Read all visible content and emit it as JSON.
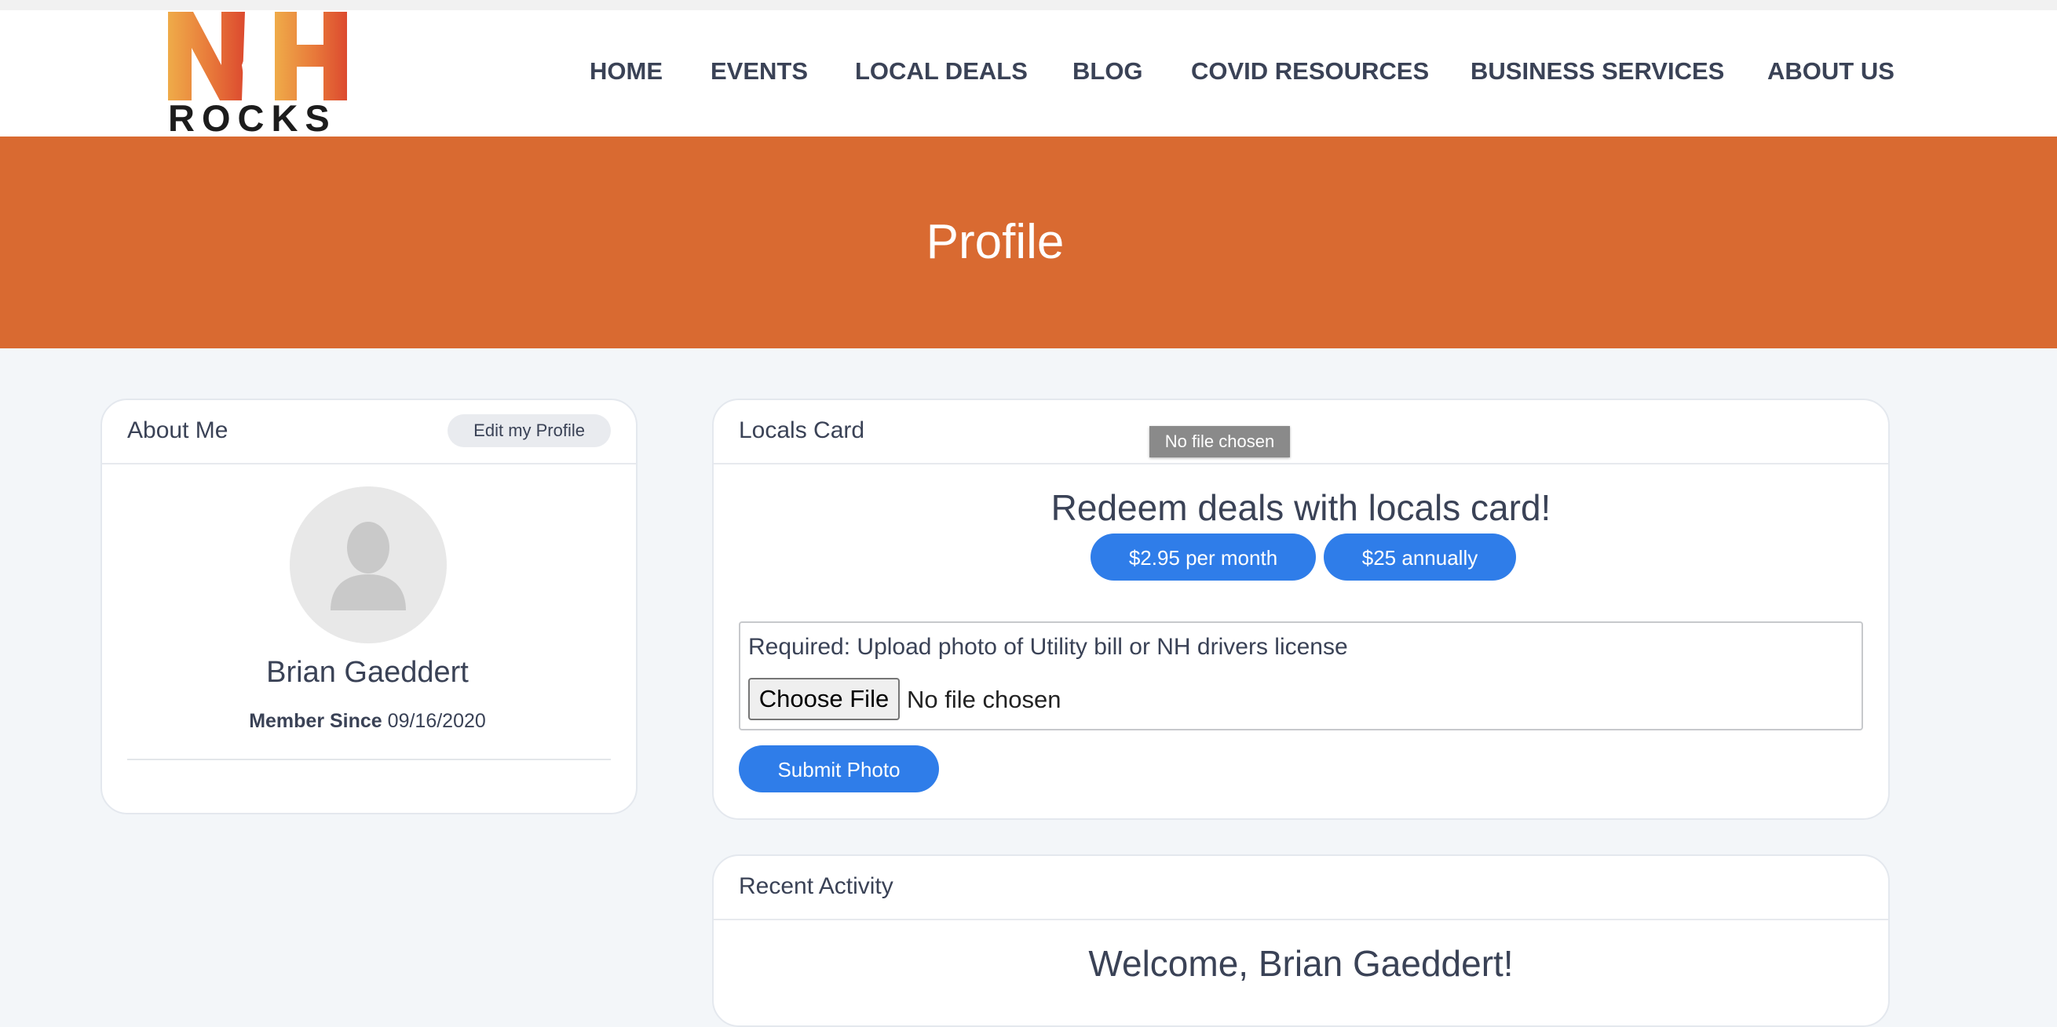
{
  "brand": {
    "logo_text": "NH",
    "logo_subtext": "ROCKS"
  },
  "nav": {
    "items": [
      "HOME",
      "EVENTS",
      "LOCAL DEALS",
      "BLOG",
      "COVID RESOURCES",
      "BUSINESS SERVICES",
      "ABOUT US"
    ]
  },
  "hero": {
    "title": "Profile"
  },
  "about": {
    "title": "About Me",
    "edit_label": "Edit my Profile",
    "name": "Brian Gaeddert",
    "member_since_label": "Member Since",
    "member_since_value": "09/16/2020"
  },
  "locals_card": {
    "title": "Locals Card",
    "headline": "Redeem deals with locals card!",
    "monthly_label": "$2.95 per month",
    "annual_label": "$25 annually",
    "upload_instruction": "Required: Upload photo of Utility bill or NH drivers license",
    "choose_file_label": "Choose File",
    "no_file_text": "No file chosen",
    "submit_label": "Submit Photo",
    "tooltip_text": "No file chosen"
  },
  "recent_activity": {
    "title": "Recent Activity",
    "welcome": "Welcome, Brian Gaeddert!"
  },
  "colors": {
    "accent_orange": "#d96a31",
    "primary_blue": "#2f7de9",
    "text_dark": "#3a4256",
    "page_bg": "#f3f6f9"
  },
  "icons": {
    "avatar": "user-silhouette-icon"
  }
}
